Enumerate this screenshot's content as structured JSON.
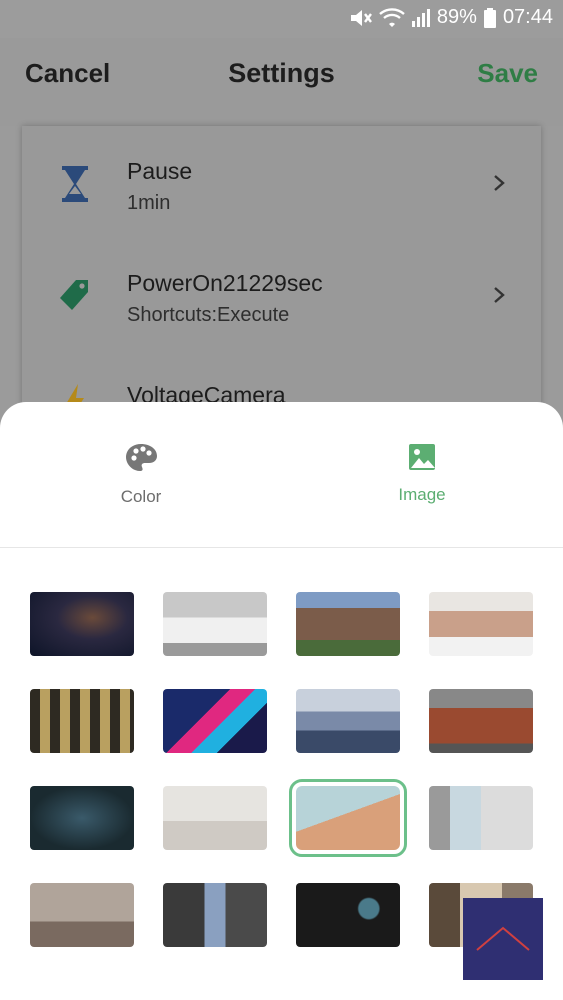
{
  "status_bar": {
    "battery": "89%",
    "time": "07:44",
    "icons": [
      "mute-icon",
      "wifi-icon",
      "signal-icon",
      "battery-icon"
    ]
  },
  "header": {
    "cancel": "Cancel",
    "title": "Settings",
    "save": "Save"
  },
  "list": [
    {
      "title": "Pause",
      "subtitle": "1min",
      "icon": "hourglass-icon"
    },
    {
      "title": "PowerOn21229sec",
      "subtitle": "Shortcuts:Execute",
      "icon": "tag-icon"
    },
    {
      "title": "VoltageCamera",
      "subtitle": "",
      "icon": "lightning-icon"
    }
  ],
  "sheet": {
    "tabs": [
      {
        "label": "Color",
        "icon": "palette-icon",
        "active": false
      },
      {
        "label": "Image",
        "icon": "image-icon",
        "active": true
      }
    ],
    "thumbnails": [
      "galaxy-sky",
      "modern-house",
      "suburban-house",
      "family-laptop",
      "office-building-night",
      "neon-keyboard",
      "misty-forest",
      "european-townhouses",
      "game-controller",
      "white-bedroom",
      "building-sky-selected",
      "window-curtains",
      "living-room",
      "hotel-bedroom",
      "vinyl-record",
      "bedroom-window"
    ],
    "selected_index": 10
  },
  "colors": {
    "save": "#2f7d45",
    "active_tab": "#5cae72",
    "inactive_tab": "#6d6d6d",
    "selection": "#6cc08a"
  }
}
